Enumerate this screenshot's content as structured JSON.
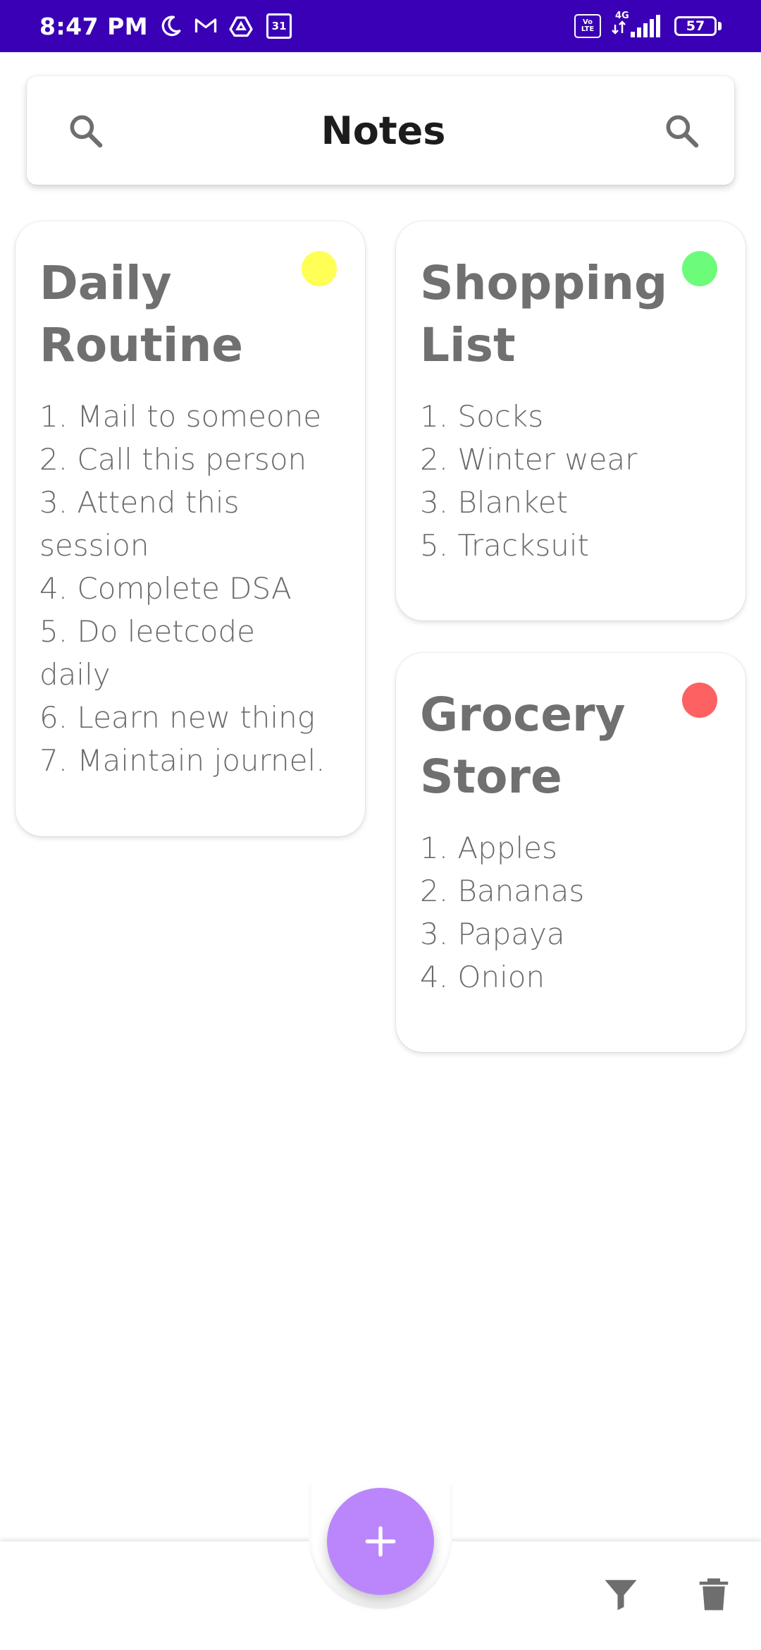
{
  "status_bar": {
    "time": "8:47 PM",
    "calendar_day": "31",
    "volte_top": "Vo",
    "volte_bottom": "LTE",
    "network": "4G",
    "battery": "57",
    "background": "#3a00b6"
  },
  "header": {
    "title": "Notes",
    "left_icon": "search-icon",
    "right_icon": "search-icon"
  },
  "notes": [
    {
      "title_line1": "Daily",
      "title_line2": "Routine",
      "dot_color": "#ffff55",
      "items": [
        "1.  Mail to someone",
        "2. Call this person",
        "3. Attend this",
        "session",
        "4. Complete DSA",
        "5. Do leetcode",
        "daily",
        "6. Learn new thing",
        "7. Maintain journel."
      ]
    },
    {
      "title_line1": "Shopping",
      "title_line2": "List",
      "dot_color": "#6dfb7a",
      "items": [
        "1. Socks",
        "2. Winter wear",
        "3. Blanket",
        "5. Tracksuit"
      ]
    },
    {
      "title_line1": "Grocery",
      "title_line2": "Store",
      "dot_color": "#fd6161",
      "items": [
        "1. Apples",
        "2. Bananas",
        "3. Papaya",
        "4. Onion"
      ]
    }
  ],
  "bottom_bar": {
    "fab_icon": "plus-icon",
    "fab_color": "#bb86fc",
    "actions": [
      "filter-icon",
      "trash-icon"
    ]
  }
}
